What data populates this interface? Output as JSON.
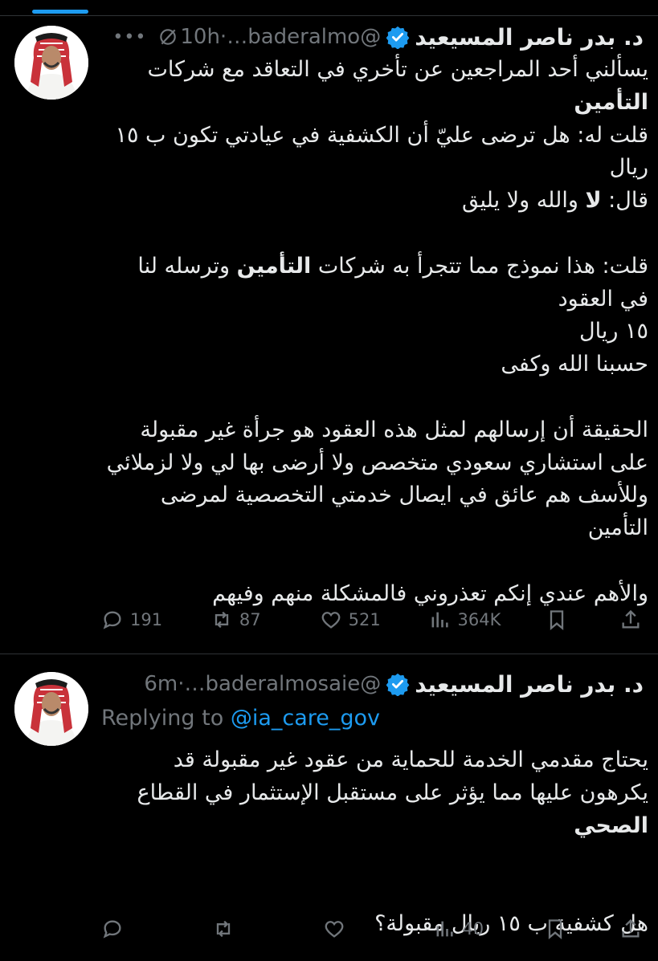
{
  "tweets": [
    {
      "author_name": "د. بدر ناصر المسيعيد",
      "handle": "@baderalmo…",
      "time": "10h",
      "body_html": "يسألني أحد المراجعين عن تأخري في التعاقد مع شركات\n<b>التأمين</b>\nقلت له: هل ترضى عليّ أن الكشفية في عيادتي تكون ب ١٥\nريال\nقال: <b>لا</b> والله ولا يليق\n\nقلت: هذا نموذج مما تتجرأ به شركات <b>التأمين</b> وترسله لنا\nفي العقود\n١٥ ريال\nحسبنا الله وكفى\n\nالحقيقة أن إرسالهم لمثل هذه العقود هو جرأة غير مقبولة\nعلى استشاري سعودي متخصص ولا أرضى بها لي ولا لزملائي\nوللأسف هم عائق في ايصال خدمتي التخصصية لمرضى\nالتأمين\n\nوالأهم عندي إنكم تعذروني فالمشكلة منهم وفيهم",
      "stats": {
        "replies": "191",
        "reposts": "87",
        "likes": "521",
        "views": "364K"
      }
    },
    {
      "author_name": "د. بدر ناصر المسيعيد",
      "handle": "@baderalmosaie…",
      "time": "6m",
      "replying_prefix": "Replying to ",
      "replying_to": "@ia_care_gov",
      "body_html": "يحتاج مقدمي الخدمة للحماية من عقود غير مقبولة قد\nيكرهون عليها مما يؤثر على مستقبل الإستثمار في القطاع\n<b>الصحي</b>\n\n\nهل كشفية ب ١٥ ريال مقبولة؟",
      "stats": {
        "replies": "",
        "reposts": "",
        "likes": "",
        "views": "40"
      }
    }
  ],
  "colors": {
    "accent": "#1d9bf0",
    "muted": "#71767b",
    "text": "#e7e9ea",
    "border": "#2f3336"
  },
  "icons": [
    "verified-badge-icon",
    "mute-icon",
    "more-icon",
    "reply-icon",
    "repost-icon",
    "like-icon",
    "views-icon",
    "bookmark-icon",
    "share-icon"
  ]
}
